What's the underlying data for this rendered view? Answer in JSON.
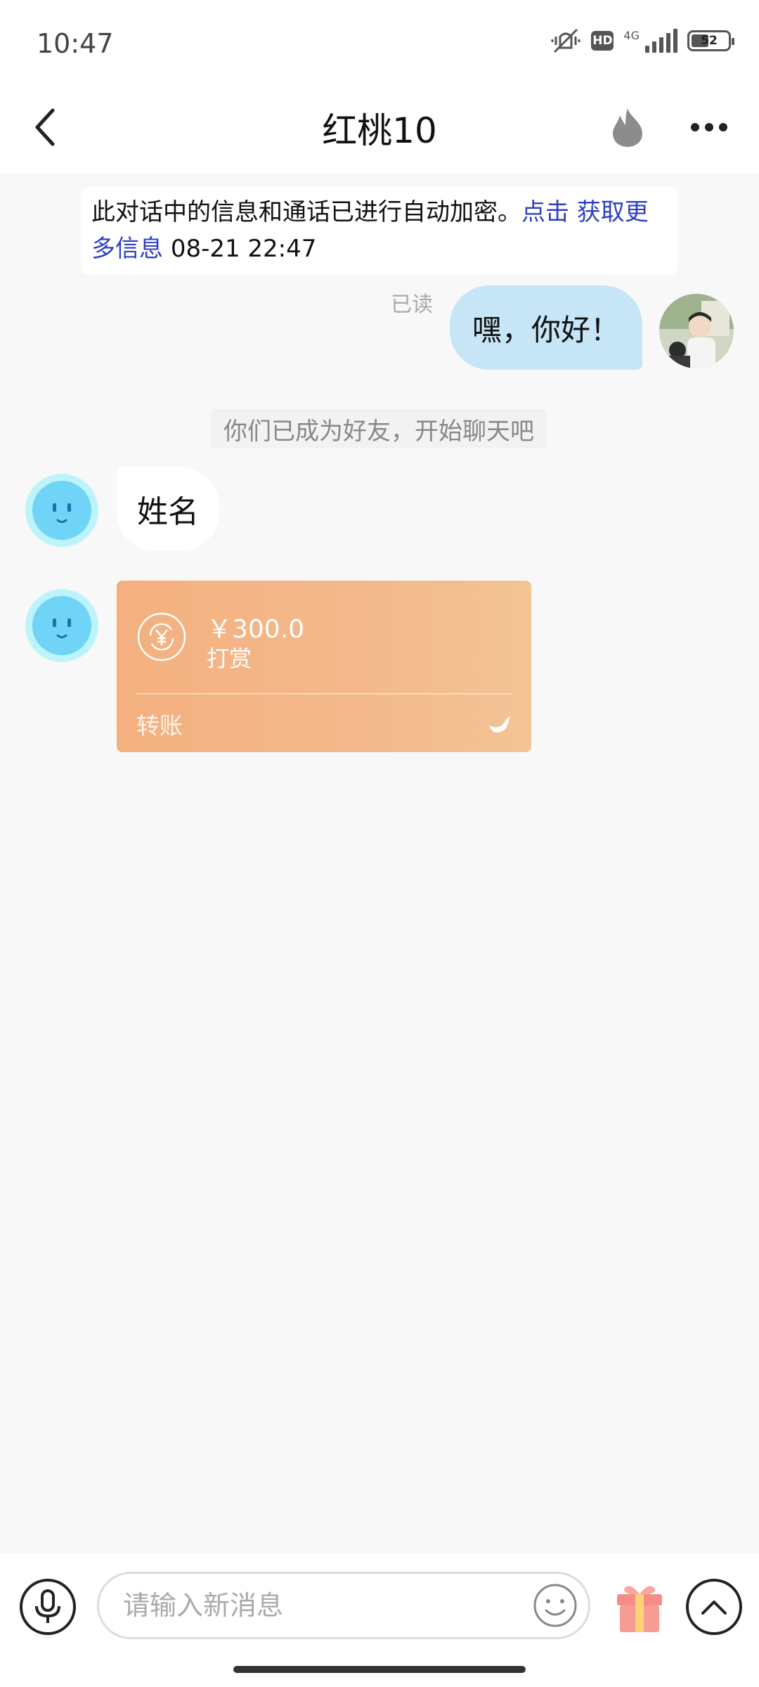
{
  "status_bar": {
    "time": "10:47",
    "network": "4G",
    "battery": "52"
  },
  "header": {
    "title": "红桃10"
  },
  "notice": {
    "text": "此对话中的信息和通话已进行自动加密。",
    "link": "点击 获取更多信息",
    "time": "08-21 22:47"
  },
  "messages": {
    "outgoing_text": "嘿，你好！",
    "read_status": "已读",
    "system": "你们已成为好友，开始聊天吧",
    "incoming_text": "姓名"
  },
  "transfer": {
    "amount": "￥300.0",
    "note": "打赏",
    "label": "转账"
  },
  "input": {
    "placeholder": "请输入新消息"
  },
  "colors": {
    "accent_link": "#2f3fc4",
    "bubble_out": "#c6e5f6",
    "transfer_card": "#f4b07f"
  },
  "icons": [
    "back-icon",
    "fire-icon",
    "more-icon",
    "microphone-icon",
    "emoji-icon",
    "gift-icon",
    "chevron-up-icon",
    "yuan-exchange-icon",
    "bird-icon"
  ]
}
